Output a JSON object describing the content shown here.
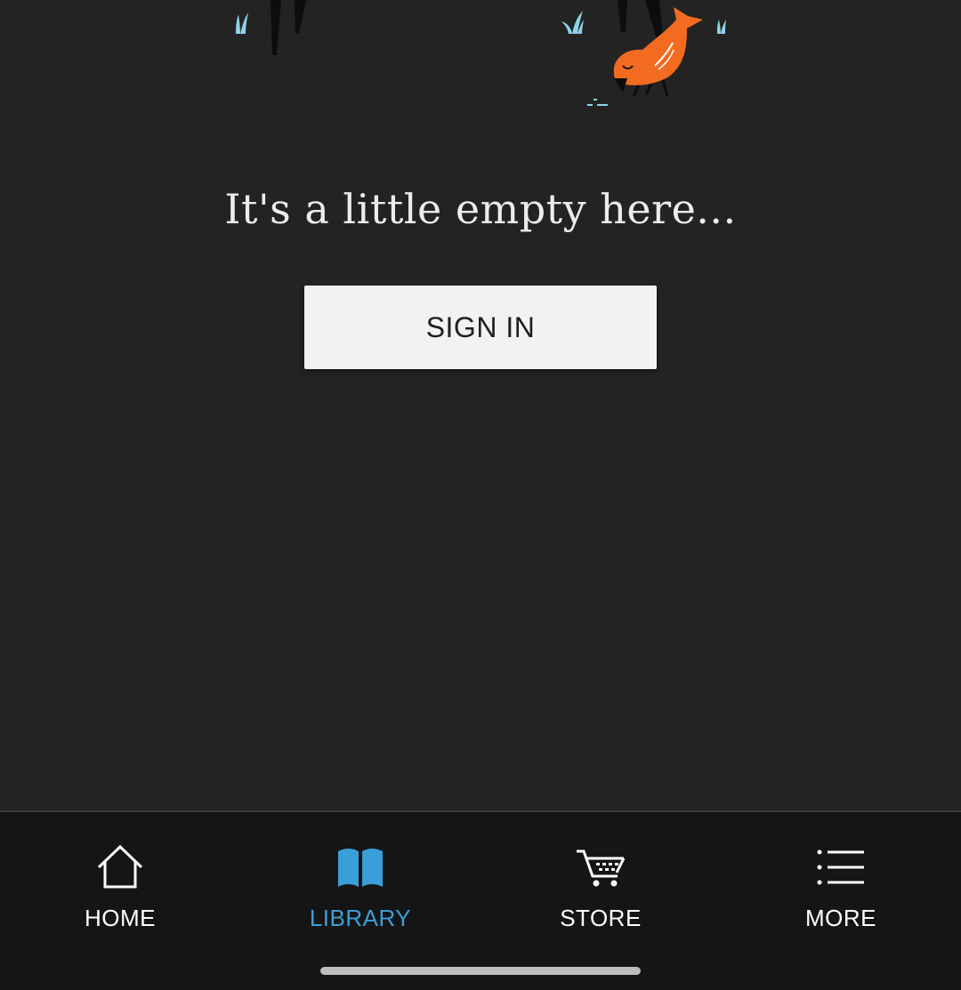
{
  "empty_state": {
    "message": "It's a little empty here...",
    "illustration_icon": "bird-illustration-icon",
    "sign_in_label": "SIGN IN"
  },
  "bottom_nav": {
    "items": [
      {
        "label": "HOME",
        "icon": "home-icon",
        "active": false
      },
      {
        "label": "LIBRARY",
        "icon": "book-icon",
        "active": true
      },
      {
        "label": "STORE",
        "icon": "cart-icon",
        "active": false
      },
      {
        "label": "MORE",
        "icon": "menu-list-icon",
        "active": false
      }
    ]
  },
  "colors": {
    "background": "#232323",
    "nav_background": "#151515",
    "accent": "#3a9fd8",
    "bird": "#f26b21",
    "grass": "#8fd3ea",
    "button": "#f2f2f2"
  }
}
